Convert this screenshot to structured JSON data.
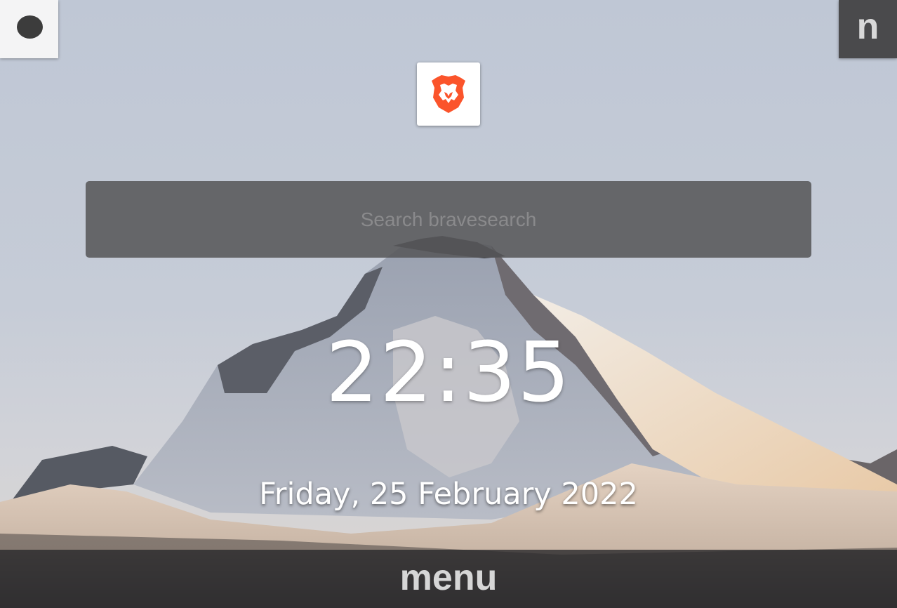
{
  "top_left": {
    "icon": "theme-toggle-dot-icon"
  },
  "top_right": {
    "label": "n"
  },
  "logo": {
    "icon": "brave-lion-icon",
    "color": "#fb542b"
  },
  "search": {
    "placeholder": "Search bravesearch",
    "value": ""
  },
  "clock": {
    "time": "22:35"
  },
  "date": {
    "text": "Friday, 25 February 2022"
  },
  "menu": {
    "label": "menu"
  },
  "wallpaper": {
    "description_icon": "mountain-wallpaper"
  }
}
